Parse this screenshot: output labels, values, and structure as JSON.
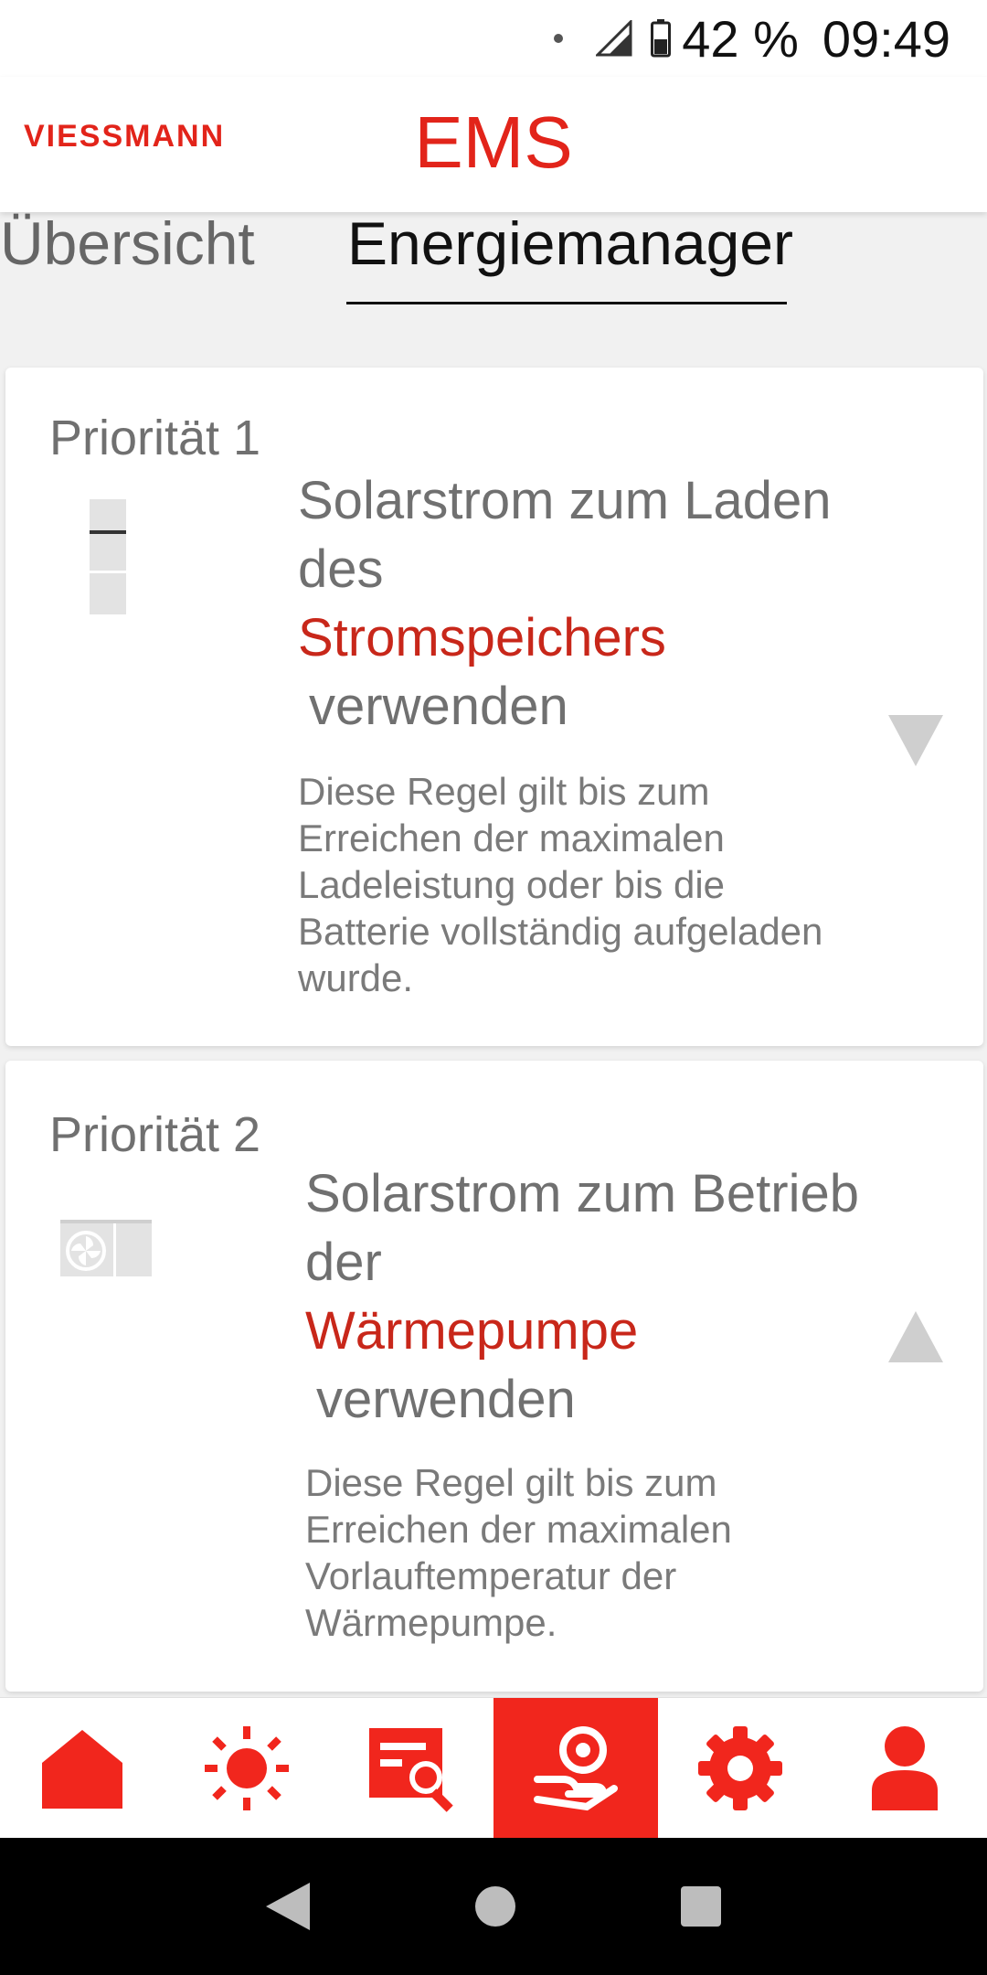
{
  "status_bar": {
    "battery_percent": "42 %",
    "time": "09:49"
  },
  "header": {
    "brand": "VIESSMANN",
    "title": "EMS"
  },
  "tabs": [
    {
      "label": "Übersicht",
      "active": false
    },
    {
      "label": "Energiemanager",
      "active": true
    }
  ],
  "cards": [
    {
      "priority": "Priorität 1",
      "title_line1": "Solarstrom zum Laden des",
      "title_accent": "Stromspeichers",
      "title_tail": "verwenden",
      "description": "Diese Regel gilt bis zum Erreichen der maximalen Ladeleistung oder bis die Batterie vollständig aufgeladen wurde.",
      "icon": "battery-storage-icon",
      "chevron": "chevron-down-icon"
    },
    {
      "priority": "Priorität 2",
      "title_line1": "Solarstrom zum Betrieb der",
      "title_accent": "Wärmepumpe",
      "title_tail": "verwenden",
      "description": "Diese Regel gilt bis zum Erreichen der maximalen Vorlauftemperatur der Wärmepumpe.",
      "icon": "heat-pump-icon",
      "chevron": "chevron-up-icon"
    }
  ],
  "bottom_nav": [
    {
      "icon": "home-icon",
      "active": false
    },
    {
      "icon": "sun-icon",
      "active": false
    },
    {
      "icon": "search-list-icon",
      "active": false
    },
    {
      "icon": "energy-hand-icon",
      "active": true
    },
    {
      "icon": "gear-icon",
      "active": false
    },
    {
      "icon": "user-icon",
      "active": false
    }
  ],
  "colors": {
    "accent": "#e2241a",
    "active_nav": "#f1261d",
    "text_gray": "#707070"
  }
}
